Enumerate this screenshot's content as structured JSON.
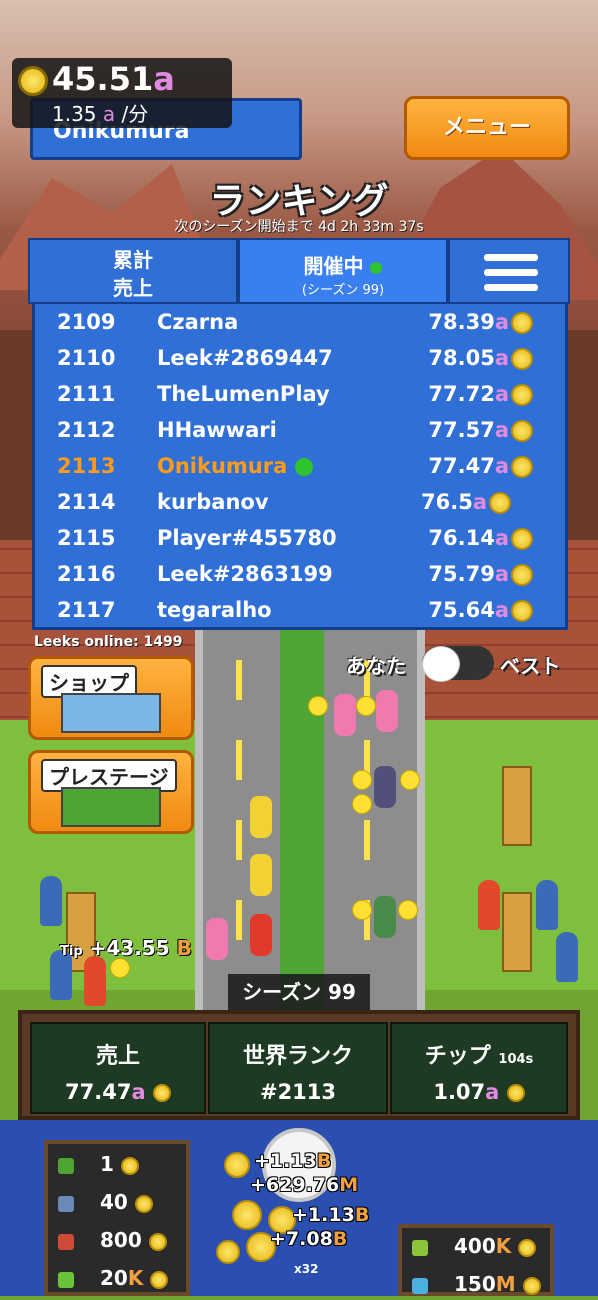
{
  "header": {
    "currency_amount": "45.51",
    "currency_unit": "a",
    "rate_prefix": "1.35",
    "rate_unit": "a",
    "rate_suffix": "/分",
    "player_name": "Onikumura",
    "menu_label": "メニュー"
  },
  "ranking": {
    "title": "ランキング",
    "countdown": "次のシーズン開始まで 4d 2h 33m 37s",
    "tabs": {
      "total_line1": "累計",
      "total_line2": "売上",
      "current_line1": "開催中",
      "current_line2": "(シーズン 99)"
    },
    "rows": [
      {
        "rank": "2109",
        "name": "Czarna",
        "score": "78.39",
        "unit": "a"
      },
      {
        "rank": "2110",
        "name": "Leek#2869447",
        "score": "78.05",
        "unit": "a"
      },
      {
        "rank": "2111",
        "name": "TheLumenPlay",
        "score": "77.72",
        "unit": "a"
      },
      {
        "rank": "2112",
        "name": "HHawwari",
        "score": "77.57",
        "unit": "a"
      },
      {
        "rank": "2113",
        "name": "Onikumura",
        "score": "77.47",
        "unit": "a",
        "is_me": true
      },
      {
        "rank": "2114",
        "name": "kurbanov",
        "score": "76.5",
        "unit": "a"
      },
      {
        "rank": "2115",
        "name": "Player#455780",
        "score": "76.14",
        "unit": "a"
      },
      {
        "rank": "2116",
        "name": "Leek#2863199",
        "score": "75.79",
        "unit": "a"
      },
      {
        "rank": "2117",
        "name": "tegaralho",
        "score": "75.64",
        "unit": "a"
      }
    ]
  },
  "online": "Leeks online: 1499",
  "buttons": {
    "shop": "ショップ",
    "prestige": "プレステージ"
  },
  "toggle": {
    "left": "あなた",
    "right": "ベスト"
  },
  "tip": {
    "label": "Tip",
    "amount": "+43.55",
    "unit": "B"
  },
  "season_label": "シーズン 99",
  "stats": {
    "sales_title": "売上",
    "sales_value": "77.47",
    "sales_unit": "a",
    "world_rank_title": "世界ランク",
    "world_rank_value": "#2113",
    "tip_title": "チップ",
    "tip_timer": "104s",
    "tip_value": "1.07",
    "tip_unit": "a"
  },
  "prices": [
    {
      "value": "1",
      "unit": ""
    },
    {
      "value": "40",
      "unit": ""
    },
    {
      "value": "800",
      "unit": ""
    },
    {
      "value": "20",
      "unit": "K"
    }
  ],
  "prices_right": [
    {
      "value": "400",
      "unit": "K"
    },
    {
      "value": "150",
      "unit": "M"
    }
  ],
  "floating": [
    {
      "value": "+1.13",
      "unit": "B"
    },
    {
      "value": "+629.76",
      "unit": "M"
    },
    {
      "value": "+1.13",
      "unit": "B"
    },
    {
      "value": "+7.08",
      "unit": "B"
    }
  ],
  "multiplier": "x32",
  "colors": {
    "accent_orange": "#f08a10",
    "panel_blue": "#2f6fd6",
    "highlight_rank": "#ff9b1a",
    "online_dot": "#2ec42e"
  }
}
